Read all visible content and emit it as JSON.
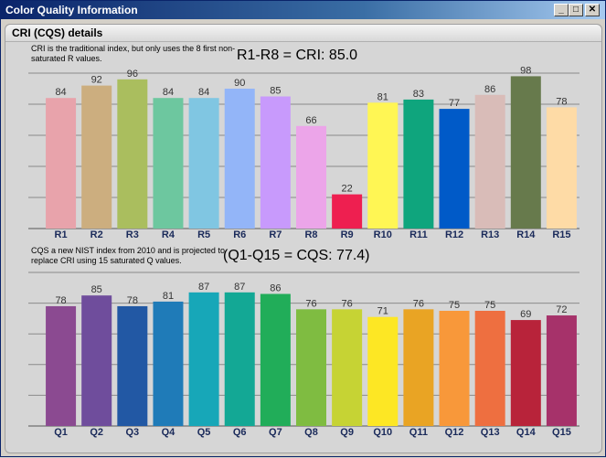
{
  "window": {
    "title": "Color Quality Information"
  },
  "panel": {
    "title": "CRI (CQS) details"
  },
  "cri": {
    "note": "CRI is the traditional index, but only uses the 8 first non-saturated R values.",
    "headline": "R1-R8 = CRI: 85.0"
  },
  "cqs": {
    "note": "CQS a new NIST index from 2010 and is projected to replace CRI using 15 saturated Q values.",
    "headline": "(Q1-Q15 = CQS: 77.4)"
  },
  "chart_data": [
    {
      "type": "bar",
      "categories": [
        "R1",
        "R2",
        "R3",
        "R4",
        "R5",
        "R6",
        "R7",
        "R8",
        "R9",
        "R10",
        "R11",
        "R12",
        "R13",
        "R14",
        "R15"
      ],
      "values": [
        84,
        92,
        96,
        84,
        84,
        90,
        85,
        66,
        22,
        81,
        83,
        77,
        86,
        98,
        78
      ],
      "colors": [
        "#e8a3ab",
        "#ccae7f",
        "#aabe5e",
        "#6dc79f",
        "#80c6e2",
        "#93b5f8",
        "#c89afc",
        "#eca5e9",
        "#ee1f50",
        "#fff654",
        "#0fa57d",
        "#005ac8",
        "#d9bcb8",
        "#677a4c",
        "#fedba6"
      ],
      "ylim": [
        0,
        100
      ],
      "grid": true,
      "data_labels": true
    },
    {
      "type": "bar",
      "categories": [
        "Q1",
        "Q2",
        "Q3",
        "Q4",
        "Q5",
        "Q6",
        "Q7",
        "Q8",
        "Q9",
        "Q10",
        "Q11",
        "Q12",
        "Q13",
        "Q14",
        "Q15"
      ],
      "values": [
        78,
        85,
        78,
        81,
        87,
        87,
        86,
        76,
        76,
        71,
        76,
        75,
        75,
        69,
        72
      ],
      "colors": [
        "#8b4a91",
        "#6f4d9c",
        "#2258a4",
        "#1f7bb8",
        "#17a7b8",
        "#13a895",
        "#21ad59",
        "#7fbc41",
        "#c6d334",
        "#fde724",
        "#e9a424",
        "#f8983a",
        "#ee6f40",
        "#b8233a",
        "#a6326a"
      ],
      "ylim": [
        0,
        100
      ],
      "grid": true,
      "data_labels": true
    }
  ]
}
